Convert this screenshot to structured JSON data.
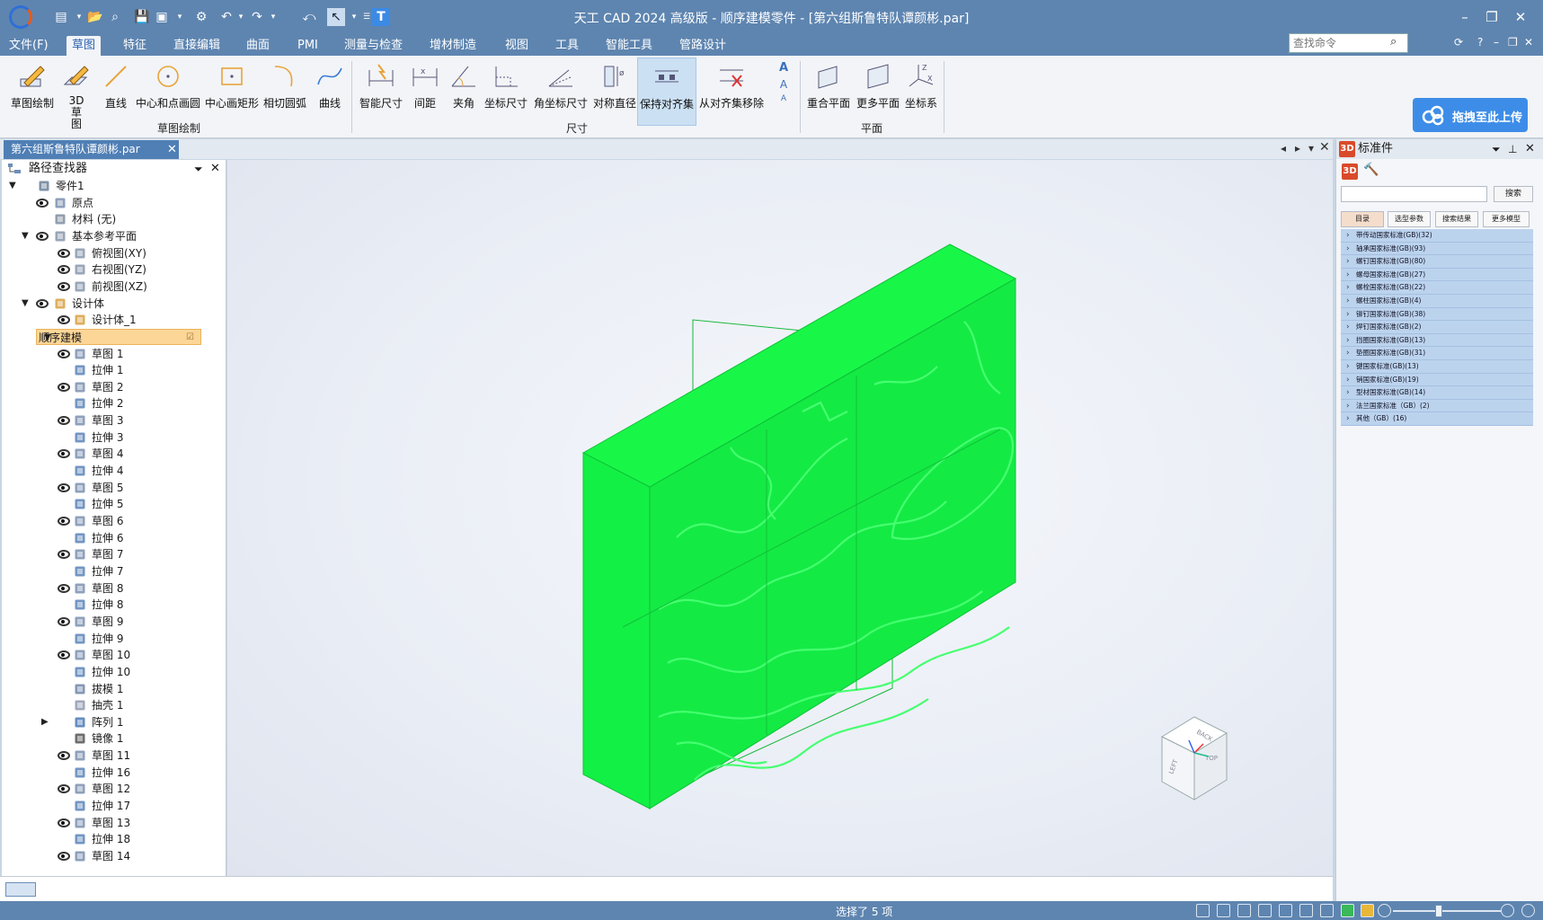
{
  "window": {
    "title": "天工 CAD 2024 高级版 - 顺序建模零件 - [第六组斯鲁特队谭颜彬.par]",
    "minimize": "–",
    "maximize": "❐",
    "close": "✕"
  },
  "menu": {
    "tabs": [
      "文件(F)",
      "草图",
      "特征",
      "直接编辑",
      "曲面",
      "PMI",
      "测量与检查",
      "增材制造",
      "视图",
      "工具",
      "智能工具",
      "管路设计"
    ],
    "active": "草图",
    "search_placeholder": "查找命令",
    "help": "?"
  },
  "ribbon": {
    "sketch_group": {
      "label": "草图绘制",
      "buttons": [
        "草图绘制",
        "3D 草图",
        "直线",
        "中心和点画圆",
        "中心画矩形",
        "相切圆弧",
        "曲线"
      ]
    },
    "dimension_group": {
      "label": "尺寸",
      "buttons": [
        "智能尺寸",
        "间距",
        "夹角",
        "坐标尺寸",
        "角坐标尺寸",
        "对称直径",
        "保持对齐集",
        "从对齐集移除"
      ]
    },
    "plane_group": {
      "label": "平面",
      "buttons": [
        "重合平面",
        "更多平面",
        "坐标系"
      ]
    },
    "upload_label": "拖拽至此上传"
  },
  "document": {
    "tab_label": "第六组斯鲁特队谭颜彬.par",
    "tab_close": "✕"
  },
  "pathfinder": {
    "title": "路径查找器",
    "rows": [
      {
        "label": "零件1",
        "level": 0,
        "expanded": true,
        "eye": false,
        "icon": "part-icon"
      },
      {
        "label": "原点",
        "level": 1,
        "eye": true,
        "icon": "origin-icon"
      },
      {
        "label": "材料 (无)",
        "level": 1,
        "eye": false,
        "icon": "material-icon"
      },
      {
        "label": "基本参考平面",
        "level": 1,
        "expanded": true,
        "eye": true,
        "icon": "plane-icon"
      },
      {
        "label": "俯视图(XY)",
        "level": 2,
        "eye": true,
        "icon": "plane-icon"
      },
      {
        "label": "右视图(YZ)",
        "level": 2,
        "eye": true,
        "icon": "plane-icon"
      },
      {
        "label": "前视图(XZ)",
        "level": 2,
        "eye": true,
        "icon": "plane-icon"
      },
      {
        "label": "设计体",
        "level": 1,
        "expanded": true,
        "eye": true,
        "icon": "body-icon"
      },
      {
        "label": "设计体_1",
        "level": 2,
        "eye": true,
        "icon": "body-icon"
      },
      {
        "label": "顺序建模",
        "level": 1,
        "expanded": true,
        "eye": false,
        "icon": "",
        "highlight": true
      },
      {
        "label": "草图 1",
        "level": 2,
        "eye": true,
        "icon": "sketch-icon"
      },
      {
        "label": "拉伸 1",
        "level": 2,
        "eye": false,
        "icon": "extrude-icon"
      },
      {
        "label": "草图 2",
        "level": 2,
        "eye": true,
        "icon": "sketch-icon"
      },
      {
        "label": "拉伸 2",
        "level": 2,
        "eye": false,
        "icon": "extrude-icon"
      },
      {
        "label": "草图 3",
        "level": 2,
        "eye": true,
        "icon": "sketch-icon"
      },
      {
        "label": "拉伸 3",
        "level": 2,
        "eye": false,
        "icon": "extrude-icon"
      },
      {
        "label": "草图 4",
        "level": 2,
        "eye": true,
        "icon": "sketch-icon"
      },
      {
        "label": "拉伸 4",
        "level": 2,
        "eye": false,
        "icon": "extrude-icon"
      },
      {
        "label": "草图 5",
        "level": 2,
        "eye": true,
        "icon": "sketch-icon"
      },
      {
        "label": "拉伸 5",
        "level": 2,
        "eye": false,
        "icon": "extrude-icon"
      },
      {
        "label": "草图 6",
        "level": 2,
        "eye": true,
        "icon": "sketch-icon"
      },
      {
        "label": "拉伸 6",
        "level": 2,
        "eye": false,
        "icon": "extrude-icon"
      },
      {
        "label": "草图 7",
        "level": 2,
        "eye": true,
        "icon": "sketch-icon"
      },
      {
        "label": "拉伸 7",
        "level": 2,
        "eye": false,
        "icon": "extrude-icon"
      },
      {
        "label": "草图 8",
        "level": 2,
        "eye": true,
        "icon": "sketch-icon"
      },
      {
        "label": "拉伸 8",
        "level": 2,
        "eye": false,
        "icon": "extrude-icon"
      },
      {
        "label": "草图 9",
        "level": 2,
        "eye": true,
        "icon": "sketch-icon"
      },
      {
        "label": "拉伸 9",
        "level": 2,
        "eye": false,
        "icon": "extrude-icon"
      },
      {
        "label": "草图 10",
        "level": 2,
        "eye": true,
        "icon": "sketch-icon"
      },
      {
        "label": "拉伸 10",
        "level": 2,
        "eye": false,
        "icon": "extrude-icon"
      },
      {
        "label": "拔模 1",
        "level": 2,
        "eye": false,
        "icon": "draft-icon"
      },
      {
        "label": "抽壳 1",
        "level": 2,
        "eye": false,
        "icon": "shell-icon"
      },
      {
        "label": "阵列 1",
        "level": 2,
        "eye": false,
        "icon": "pattern-icon",
        "collapsed": true
      },
      {
        "label": "镜像 1",
        "level": 2,
        "eye": false,
        "icon": "mirror-icon"
      },
      {
        "label": "草图 11",
        "level": 2,
        "eye": true,
        "icon": "sketch-icon"
      },
      {
        "label": "拉伸 16",
        "level": 2,
        "eye": false,
        "icon": "extrude-icon"
      },
      {
        "label": "草图 12",
        "level": 2,
        "eye": true,
        "icon": "sketch-icon"
      },
      {
        "label": "拉伸 17",
        "level": 2,
        "eye": false,
        "icon": "extrude-icon"
      },
      {
        "label": "草图 13",
        "level": 2,
        "eye": true,
        "icon": "sketch-icon"
      },
      {
        "label": "拉伸 18",
        "level": 2,
        "eye": false,
        "icon": "extrude-icon"
      },
      {
        "label": "草图 14",
        "level": 2,
        "eye": true,
        "icon": "sketch-icon"
      }
    ]
  },
  "standard_parts": {
    "title": "标准件",
    "search_button": "搜索",
    "tabs": [
      "目录",
      "选型参数",
      "搜索结果",
      "更多模型"
    ],
    "active_tab": "目录",
    "items": [
      "带传动国家标准(GB)(32)",
      "轴承国家标准(GB)(93)",
      "螺钉国家标准(GB)(80)",
      "螺母国家标准(GB)(27)",
      "螺栓国家标准(GB)(22)",
      "螺柱国家标准(GB)(4)",
      "铆钉国家标准(GB)(38)",
      "焊钉国家标准(GB)(2)",
      "挡圈国家标准(GB)(13)",
      "垫圈国家标准(GB)(31)",
      "键国家标准(GB)(13)",
      "销国家标准(GB)(19)",
      "型材国家标准(GB)(14)",
      "法兰国家标准（GB）(2)",
      "其他（GB）(16)"
    ]
  },
  "viewcube": {
    "faces": [
      "BACK",
      "LEFT",
      "TOP"
    ]
  },
  "status": {
    "text": "选择了 5 项"
  },
  "colors": {
    "titlebar": "#5e85b0",
    "model_green": "#16f646",
    "ribbon": "#f2f4f7",
    "highlight": "#fbd697"
  }
}
